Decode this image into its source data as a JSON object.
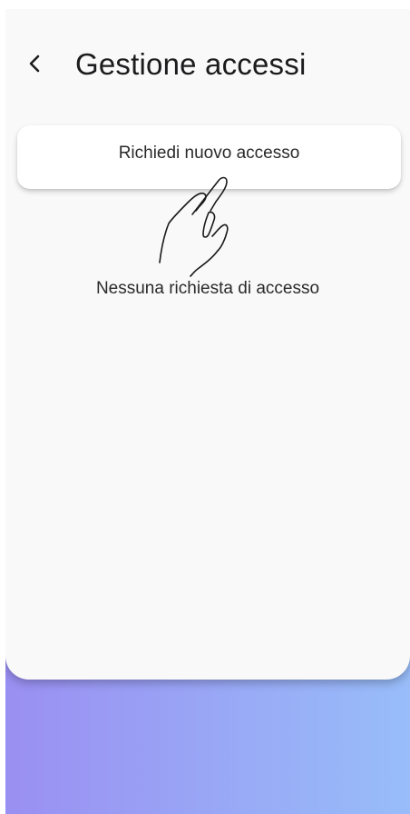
{
  "header": {
    "title": "Gestione accessi",
    "back_icon": "chevron-left-icon"
  },
  "actions": {
    "request_button_label": "Richiedi nuovo accesso"
  },
  "main": {
    "empty_message": "Nessuna richiesta di accesso"
  },
  "overlay": {
    "icon": "tap-hand-icon"
  },
  "colors": {
    "card_background": "#f9f9f9",
    "gradient_start": "#9a8ff2",
    "gradient_end": "#98bdf9",
    "text_primary": "#1c1c1e"
  }
}
